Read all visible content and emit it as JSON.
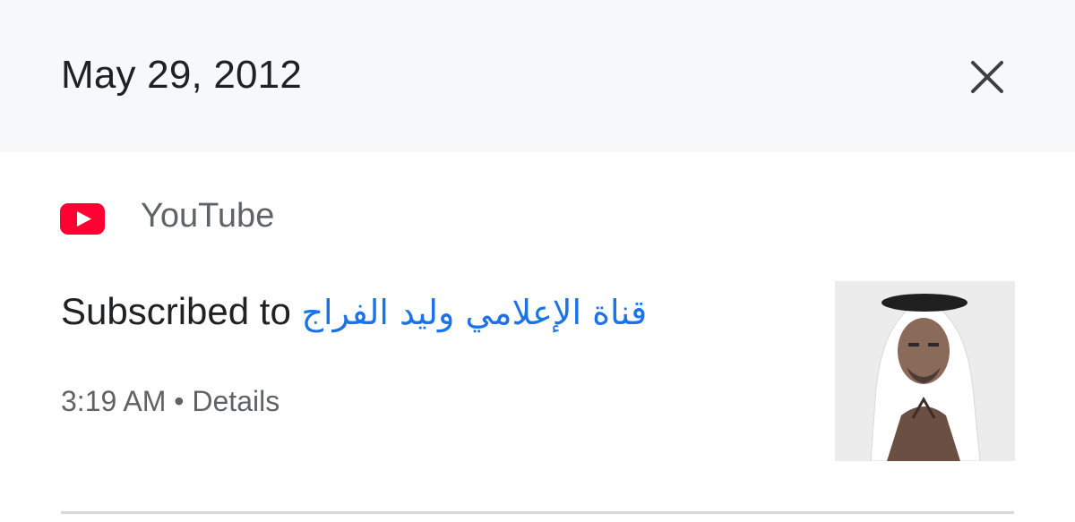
{
  "header": {
    "date": "May 29, 2012"
  },
  "card": {
    "source": "YouTube",
    "activity_prefix": "Subscribed to",
    "channel_name": "قناة الإعلامي وليد الفراج",
    "time": "3:19 AM",
    "separator": "•",
    "details_label": "Details",
    "thumbnail_alt": "Channel thumbnail",
    "colors": {
      "youtube_red": "#ff0033",
      "link_blue": "#1a73e8"
    },
    "icons": {
      "source": "youtube-logo-icon",
      "close": "close-icon"
    }
  }
}
